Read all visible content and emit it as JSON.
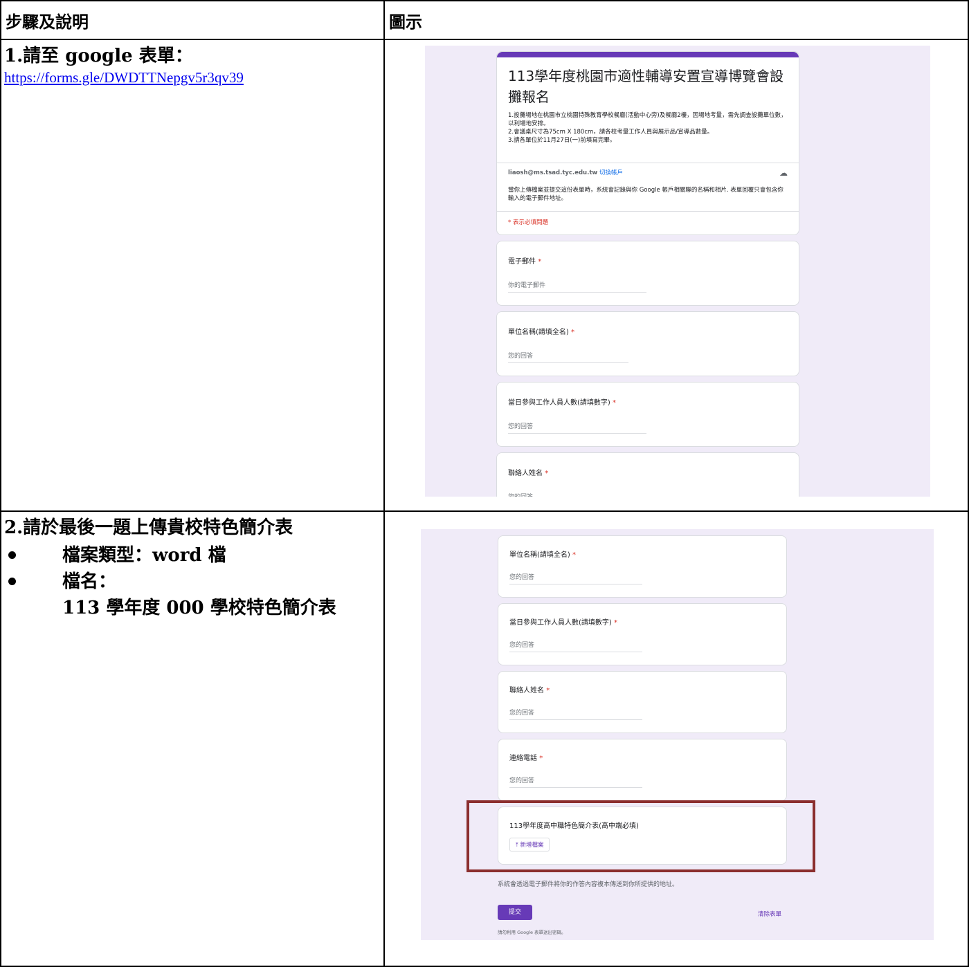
{
  "header": {
    "col1": "步驟及說明",
    "col2": "圖示"
  },
  "step1": {
    "title": "1.請至 google 表單：",
    "link": "https://forms.gle/DWDTTNepgv5r3qv39"
  },
  "step2": {
    "title": "2.請於最後一題上傳貴校特色簡介表",
    "bullets": [
      "檔案類型：word 檔",
      "檔名："
    ],
    "filename": "113 學年度 000 學校特色簡介表"
  },
  "form1": {
    "title": "113學年度桃園市適性輔導安置宣導博覽會設攤報名",
    "desc": [
      "1.設攤場地在桃園市立桃園特殊教育學校餐廳(活動中心旁)及餐廳2樓，因場地考量，需先調查設攤單位數，以利場地安排。",
      "2.會議桌尺寸為75cm X 180cm，請各校考量工作人員與展示品/宣導品數量。",
      "3.請各單位於11月27日(一)前填寫完畢。"
    ],
    "account": "liaosh@ms.tsad.tyc.edu.tw",
    "switch_account": "切換帳戶",
    "notice": "當你上傳檔案並提交這份表單時，系統會記錄與你 Google 帳戶相關聯的名稱和相片. 表單回覆只會包含你輸入的電子郵件地址。",
    "required_note": "* 表示必填問題",
    "q_email": "電子郵件",
    "email_placeholder": "你的電子郵件",
    "q_unit": "單位名稱(請填全名)",
    "q_staff": "當日參與工作人員人數(請填數字)",
    "q_contact": "聯絡人姓名",
    "answer_placeholder": "您的回答",
    "star": "*"
  },
  "form2": {
    "q_unit": "單位名稱(請填全名)",
    "q_staff": "當日參與工作人員人數(請填數字)",
    "q_contact": "聯絡人姓名",
    "q_phone": "連絡電話",
    "answer_placeholder": "您的回答",
    "star": "*",
    "q_upload": "113學年度高中職特色簡介表(高中端必填)",
    "upload_button": "新增檔案",
    "email_notice": "系統會透過電子郵件將你的作答內容複本傳送到你所提供的地址。",
    "submit": "提交",
    "clear": "清除表單",
    "footer": "請勿利用 Google 表單送出密碼。"
  },
  "colors": {
    "accent": "#673ab7",
    "background": "#f0ebf8",
    "highlight": "#8b2e2e"
  }
}
